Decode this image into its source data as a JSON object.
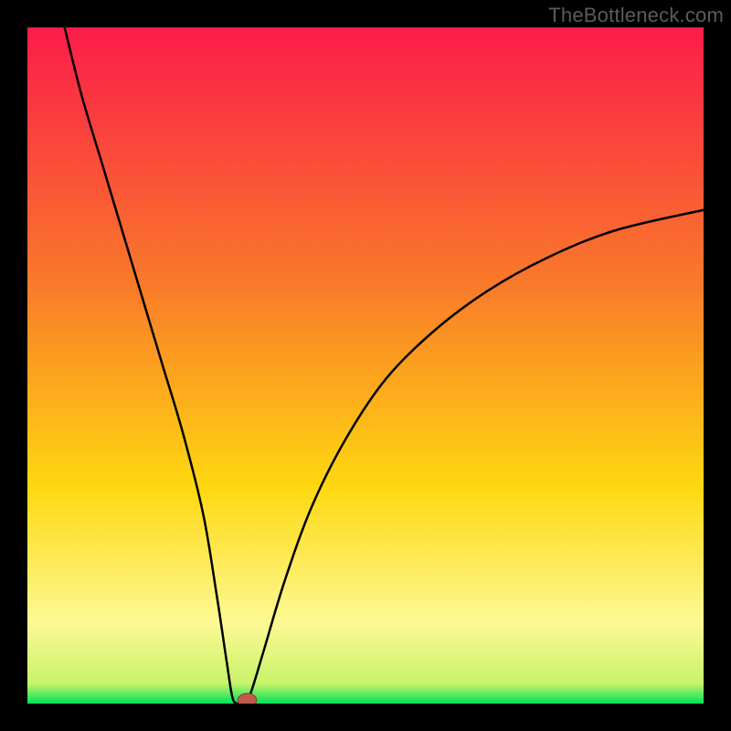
{
  "watermark": "TheBottleneck.com",
  "colors": {
    "frame": "#000000",
    "grad_top": "#fb1c4a",
    "grad_mid1": "#f97a2a",
    "grad_mid2": "#fed810",
    "grad_mid3": "#fdf994",
    "grad_bottom": "#00e357",
    "curve": "#000000",
    "marker_fill": "#c05a4e",
    "marker_stroke": "#8f3e36"
  },
  "chart_data": {
    "type": "line",
    "title": "",
    "xlabel": "",
    "ylabel": "",
    "xlim": [
      0,
      100
    ],
    "ylim": [
      0,
      100
    ],
    "notch_x": 31,
    "curve": [
      {
        "x": 5.5,
        "y": 100
      },
      {
        "x": 8,
        "y": 90
      },
      {
        "x": 11,
        "y": 80
      },
      {
        "x": 14,
        "y": 70
      },
      {
        "x": 17,
        "y": 60
      },
      {
        "x": 20,
        "y": 50
      },
      {
        "x": 23,
        "y": 40
      },
      {
        "x": 26,
        "y": 28
      },
      {
        "x": 28,
        "y": 16
      },
      {
        "x": 29.5,
        "y": 6
      },
      {
        "x": 30.3,
        "y": 1
      },
      {
        "x": 31,
        "y": 0
      },
      {
        "x": 32,
        "y": 0
      },
      {
        "x": 33,
        "y": 1.5
      },
      {
        "x": 35,
        "y": 8
      },
      {
        "x": 38,
        "y": 18
      },
      {
        "x": 42,
        "y": 29
      },
      {
        "x": 47,
        "y": 39
      },
      {
        "x": 53,
        "y": 48
      },
      {
        "x": 60,
        "y": 55
      },
      {
        "x": 68,
        "y": 61
      },
      {
        "x": 77,
        "y": 66
      },
      {
        "x": 87,
        "y": 70
      },
      {
        "x": 100,
        "y": 73
      }
    ],
    "marker": {
      "x": 32.5,
      "y": 0.5,
      "rx": 1.4,
      "ry": 1.0
    }
  }
}
